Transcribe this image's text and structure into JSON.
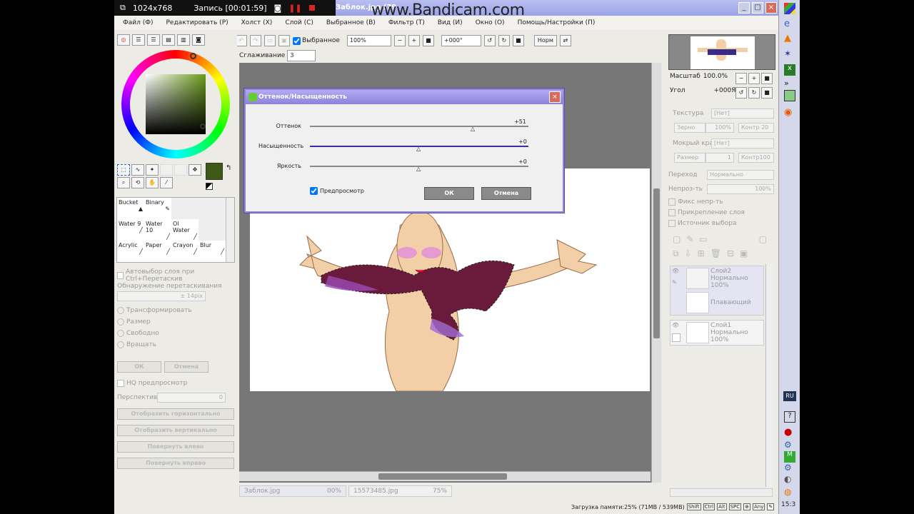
{
  "recorder": {
    "resolution": "1024x768",
    "recording": "Запись [00:01:59]",
    "watermark": "www.Bandicam.com"
  },
  "window": {
    "title": "Заблок.jpg (79"
  },
  "menu": [
    "Файл (Ф)",
    "Редактировать (Р)",
    "Холст (Х)",
    "Слой (С)",
    "Выбранное (В)",
    "Фильтр (Т)",
    "Вид (И)",
    "Окно (О)",
    "Помощь/Настройки (П)"
  ],
  "toolbar": {
    "selected_label": "Выбранное",
    "zoom": "100%",
    "angle": "+000°",
    "norm": "Норм",
    "smoothing_label": "Сглаживание",
    "smoothing": "3"
  },
  "colors": {
    "current": "#3e5a14",
    "accent": "#8f84d8",
    "titlebar": "#9aa3e6",
    "canvas_gray": "#777777"
  },
  "tools": {
    "grid": [
      [
        "Bucket",
        "Binary",
        ""
      ],
      [
        "Water 9",
        "Water 10",
        "Ol Water"
      ],
      [
        "Acrylic",
        "Paper",
        "Crayon",
        "Blur"
      ]
    ],
    "autoselect": "Автовыбор слоя при Ctrl+Перетаскив",
    "drag_detect": "Обнаружение перетаскивания",
    "drag_value": "± 14pix",
    "transform": [
      "Трансформировать",
      "Размер",
      "Свободно",
      "Вращать"
    ],
    "ok": "ОК",
    "cancel": "Отмена",
    "hq": "HQ предпросмотр",
    "perspective": "Перспектива",
    "perspective_value": "0",
    "actions": [
      "Отобразить горизонтально",
      "Отобразить вертикально",
      "Повернуть влево",
      "Повернуть вправо"
    ]
  },
  "dialog": {
    "title": "Оттенок/Насыщенность",
    "rows": [
      {
        "label": "Оттенок",
        "value": "+51",
        "pos": 0.75
      },
      {
        "label": "Насыщенность",
        "value": "+0",
        "pos": 0.5
      },
      {
        "label": "Яркость",
        "value": "+0",
        "pos": 0.5
      }
    ],
    "preview": "Предпросмотр",
    "ok": "ОК",
    "cancel": "Отмена"
  },
  "navigator": {
    "scale_label": "Масштаб",
    "scale": "100.0%",
    "angle_label": "Угол",
    "angle": "+000Я"
  },
  "layerprops": {
    "texture_label": "Текстура",
    "texture": "[Нет]",
    "grain": "Зерно",
    "grain_val": "100%",
    "contrast": "Контр 20",
    "wet_label": "Мокрый край",
    "wet": "[Нет]",
    "size": "Размер",
    "size_val": "1",
    "contrast2": "Контр100",
    "blend_label": "Переход",
    "blend": "Нормально",
    "opacity_label": "Непроз-ть",
    "opacity": "100%",
    "fix": "Фикс непр-ть",
    "clip": "Прикрепление слоя",
    "source": "Источник выбора"
  },
  "layers": [
    {
      "name": "Слой2",
      "mode": "Нормально",
      "opacity": "100%",
      "floating": "Плавающий"
    },
    {
      "name": "Слой1",
      "mode": "Нормально",
      "opacity": "100%"
    }
  ],
  "documents": [
    {
      "name": "Заблок.jpg",
      "pct": "00%"
    },
    {
      "name": "15573485.jpg",
      "pct": "75%"
    }
  ],
  "status": {
    "memory": "Загрузка памяти:25% (71MB / 539MB)",
    "keys": [
      "Shift",
      "Ctrl",
      "Alt",
      "SPC",
      "Any"
    ]
  },
  "taskbar": {
    "lang": "RU",
    "time": "15:3"
  }
}
